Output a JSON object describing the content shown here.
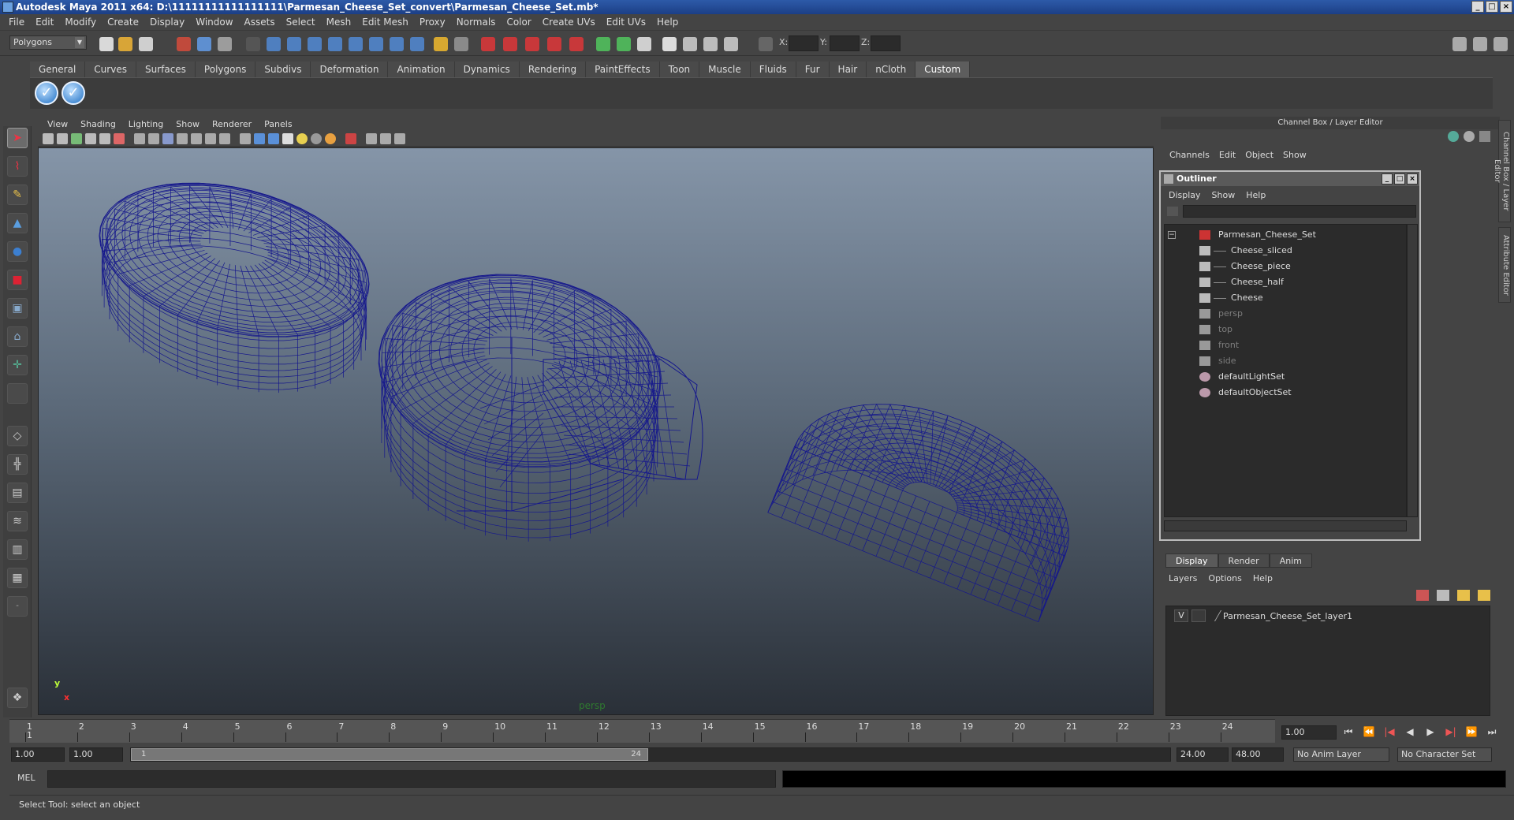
{
  "window": {
    "title": "Autodesk Maya 2011 x64: D:\\11111111111111111\\Parmesan_Cheese_Set_convert\\Parmesan_Cheese_Set.mb*",
    "min": "_",
    "max": "□",
    "close": "×"
  },
  "menubar": [
    "File",
    "Edit",
    "Modify",
    "Create",
    "Display",
    "Window",
    "Assets",
    "Select",
    "Mesh",
    "Edit Mesh",
    "Proxy",
    "Normals",
    "Color",
    "Create UVs",
    "Edit UVs",
    "Help"
  ],
  "statusline": {
    "mode": "Polygons",
    "x_label": "X:",
    "y_label": "Y:",
    "z_label": "Z:"
  },
  "shelf": {
    "tabs": [
      "General",
      "Curves",
      "Surfaces",
      "Polygons",
      "Subdivs",
      "Deformation",
      "Animation",
      "Dynamics",
      "Rendering",
      "PaintEffects",
      "Toon",
      "Muscle",
      "Fluids",
      "Fur",
      "Hair",
      "nCloth",
      "Custom"
    ],
    "active": "Custom"
  },
  "viewport": {
    "menus": [
      "View",
      "Shading",
      "Lighting",
      "Show",
      "Renderer",
      "Panels"
    ],
    "camera": "persp",
    "axis_y": "y",
    "axis_x": "x",
    "wire_color": "#16188c"
  },
  "channelbox": {
    "header": "Channel Box / Layer Editor",
    "menus": [
      "Channels",
      "Edit",
      "Object",
      "Show"
    ],
    "side_tabs": [
      "Channel Box / Layer Editor",
      "Attribute Editor"
    ]
  },
  "outliner": {
    "title": "Outliner",
    "menus": [
      "Display",
      "Show",
      "Help"
    ],
    "items": [
      {
        "label": "Parmesan_Cheese_Set",
        "dim": false
      },
      {
        "label": "Cheese_sliced",
        "dim": false
      },
      {
        "label": "Cheese_piece",
        "dim": false
      },
      {
        "label": "Cheese_half",
        "dim": false
      },
      {
        "label": "Cheese",
        "dim": false
      },
      {
        "label": "persp",
        "dim": true
      },
      {
        "label": "top",
        "dim": true
      },
      {
        "label": "front",
        "dim": true
      },
      {
        "label": "side",
        "dim": true
      },
      {
        "label": "defaultLightSet",
        "dim": false
      },
      {
        "label": "defaultObjectSet",
        "dim": false
      }
    ]
  },
  "layer_editor": {
    "tabs": [
      "Display",
      "Render",
      "Anim"
    ],
    "menus": [
      "Layers",
      "Options",
      "Help"
    ],
    "layer_visible": "V",
    "layer_name": "Parmesan_Cheese_Set_layer1"
  },
  "timeline": {
    "ticks": [
      "1",
      "2",
      "3",
      "4",
      "5",
      "6",
      "7",
      "8",
      "9",
      "10",
      "11",
      "12",
      "13",
      "14",
      "15",
      "16",
      "17",
      "18",
      "19",
      "20",
      "21",
      "22",
      "23",
      "24"
    ],
    "current_marker": "1",
    "current_frame": "1.00"
  },
  "range": {
    "start": "1.00",
    "playback_start": "1.00",
    "slider_start": "1",
    "slider_end": "24",
    "playback_end": "24.00",
    "end": "48.00",
    "anim_layer": "No Anim Layer",
    "character_set": "No Character Set"
  },
  "cmdline": {
    "label": "MEL"
  },
  "helpline": {
    "text": "Select Tool: select an object"
  }
}
